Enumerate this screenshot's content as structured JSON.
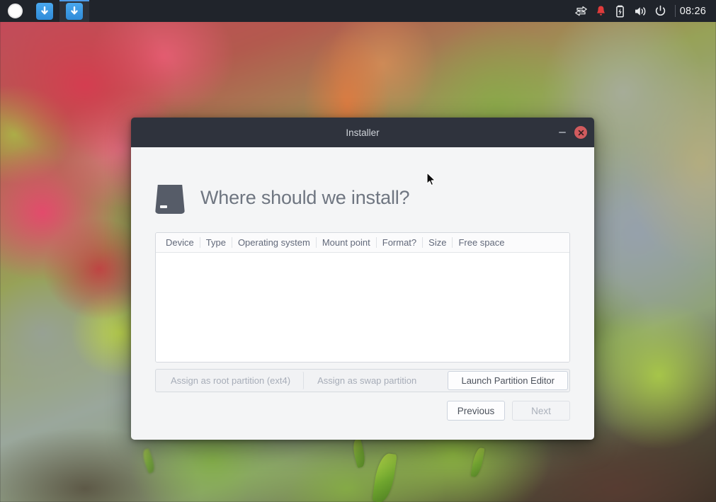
{
  "panel": {
    "launcher_items": [
      {
        "name": "app-circle-icon",
        "label": ""
      },
      {
        "name": "download-icon-1",
        "label": ""
      },
      {
        "name": "download-icon-2",
        "label": ""
      }
    ],
    "tray": [
      {
        "name": "network-transfer-icon",
        "label": ""
      },
      {
        "name": "notification-bell-icon",
        "label": ""
      },
      {
        "name": "battery-charging-icon",
        "label": ""
      },
      {
        "name": "volume-icon",
        "label": ""
      },
      {
        "name": "power-icon",
        "label": ""
      }
    ],
    "clock": "08:26"
  },
  "window": {
    "title": "Installer",
    "minimize_label": "–",
    "close_label": "✕"
  },
  "page": {
    "title": "Where should we install?",
    "drive_icon": "hard-drive-icon"
  },
  "table": {
    "columns": [
      "Device",
      "Type",
      "Operating system",
      "Mount point",
      "Format?",
      "Size",
      "Free space"
    ],
    "rows": []
  },
  "toolbar": {
    "assign_root_label": "Assign as root partition (ext4)",
    "assign_swap_label": "Assign as swap partition",
    "launch_editor_label": "Launch Partition Editor"
  },
  "navigation": {
    "previous_label": "Previous",
    "next_label": "Next"
  },
  "colors": {
    "titlebar": "#2f333d",
    "dialog_body": "#f4f5f6",
    "close_button": "#d15b5e",
    "accent_blue": "#4e9ae6",
    "heading_text": "#6f7681"
  }
}
